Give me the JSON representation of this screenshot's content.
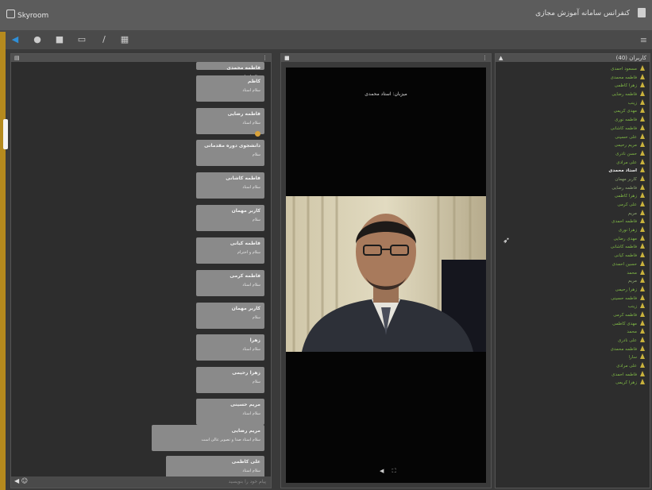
{
  "window": {
    "app_name": "Skyroom",
    "meeting_title": "کنفرانس سامانه آموزش مجازی"
  },
  "toolbar": {
    "icons": [
      "speaker-icon",
      "microphone-icon",
      "camera-icon",
      "screen-share-icon",
      "pen-icon",
      "file-icon"
    ],
    "active_color": "#2f8fd8",
    "menu_icon": "hamburger-menu-icon"
  },
  "chat": {
    "header_icon": "chat-icon",
    "input_placeholder": "پیام خود را بنویسید",
    "messages": [
      {
        "sender": "فاطمه محمدی",
        "text": "سلام استاد"
      },
      {
        "sender": "کاظم",
        "text": "سلام استاد"
      },
      {
        "sender": "فاطمه رضایی",
        "text": "سلام استاد",
        "emoji": true
      },
      {
        "sender": "دانشجوی دوره مقدماتی",
        "text": "سلام"
      },
      {
        "sender": "فاطمه کاشانی",
        "text": "سلام استاد"
      },
      {
        "sender": "کاربر مهمان",
        "text": "سلام"
      },
      {
        "sender": "فاطمه کیانی",
        "text": "سلام و احترام"
      },
      {
        "sender": "فاطمه کرمی",
        "text": "سلام استاد"
      },
      {
        "sender": "کاربر مهمان",
        "text": "سلام"
      },
      {
        "sender": "زهرا",
        "text": "سلام استاد"
      },
      {
        "sender": "زهرا رحیمی",
        "text": "سلام"
      },
      {
        "sender": "مریم حسینی",
        "text": "سلام استاد"
      },
      {
        "sender": "مریم رضایی",
        "text": "سلام استاد صدا و تصویر عالی است"
      },
      {
        "sender": "علی کاظمی",
        "text": "سلام استاد"
      }
    ]
  },
  "video": {
    "header_icon": "video-icon",
    "presenter_label": "میزبان: استاد محمدی",
    "controls": "◀ ⛶"
  },
  "attendees": {
    "header_title": "کاربران (40)",
    "people": [
      {
        "name": "مسعود احمدی"
      },
      {
        "name": "فاطمه محمدی"
      },
      {
        "name": "زهرا کاظمی"
      },
      {
        "name": "فاطمه رضایی"
      },
      {
        "name": "زینب"
      },
      {
        "name": "مهدی کریمی"
      },
      {
        "name": "فاطمه نوری"
      },
      {
        "name": "فاطمه کاشانی"
      },
      {
        "name": "علی حسینی"
      },
      {
        "name": "مریم رحیمی"
      },
      {
        "name": "حسن نادری"
      },
      {
        "name": "علی مرادی"
      },
      {
        "name": "استاد محمدی",
        "host": true
      },
      {
        "name": "کاربر مهمان",
        "dim": true
      },
      {
        "name": "فاطمه رضایی",
        "dim": true
      },
      {
        "name": "زهرا کاظمی"
      },
      {
        "name": "علی کرمی"
      },
      {
        "name": "مریم",
        "dim": true
      },
      {
        "name": "فاطمه احمدی"
      },
      {
        "name": "زهرا نوری"
      },
      {
        "name": "مهدی رضایی"
      },
      {
        "name": "فاطمه کاشانی"
      },
      {
        "name": "فاطمه کیانی"
      },
      {
        "name": "حسین احمدی"
      },
      {
        "name": "محمد"
      },
      {
        "name": "مریم",
        "dim": true
      },
      {
        "name": "زهرا رحیمی"
      },
      {
        "name": "فاطمه حسینی"
      },
      {
        "name": "زینب"
      },
      {
        "name": "فاطمه کرمی"
      },
      {
        "name": "مهدی کاظمی"
      },
      {
        "name": "محمد"
      },
      {
        "name": "علی نادری"
      },
      {
        "name": "فاطمه محمدی"
      },
      {
        "name": "سارا"
      },
      {
        "name": "علی مرادی"
      },
      {
        "name": "فاطمه احمدی"
      },
      {
        "name": "زهرا کریمی"
      }
    ]
  }
}
